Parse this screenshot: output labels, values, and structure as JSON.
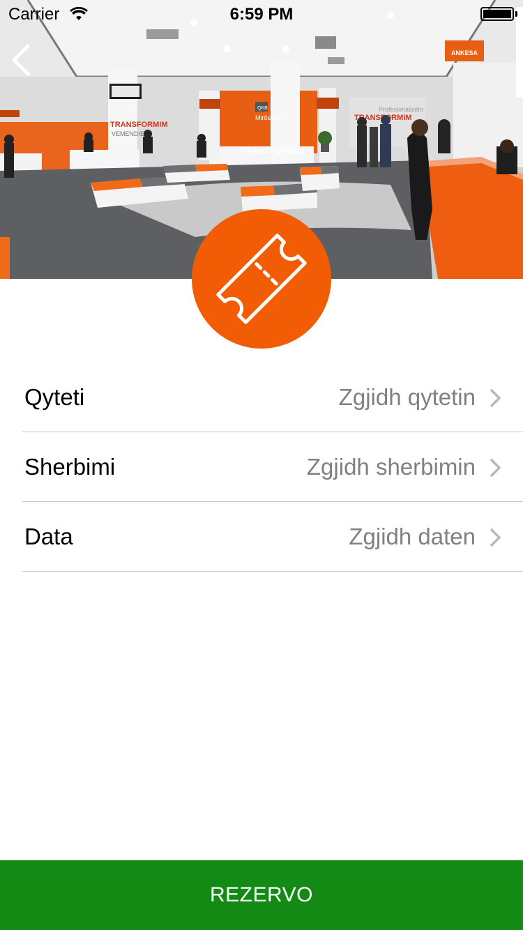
{
  "status_bar": {
    "carrier": "Carrier",
    "time": "6:59 PM",
    "wifi_icon": "wifi-icon",
    "battery_icon": "battery-icon",
    "battery_level": 1.0
  },
  "nav": {
    "back_icon": "chevron-left-icon"
  },
  "hero": {
    "image": "office-service-hall-photo",
    "ticket_icon": "ticket-icon",
    "badge_color": "#f25c05",
    "signs": {
      "ankesa": "ANKESA",
      "transformim": "TRANSFORMIM",
      "profesionalizem": "Profesionalizëm",
      "mendie": "VEMENDIE",
      "sjellje": "Mirësjellje",
      "qkb": "QKB"
    }
  },
  "form": {
    "rows": [
      {
        "label": "Qyteti",
        "value": "Zgjidh qytetin"
      },
      {
        "label": "Sherbimi",
        "value": "Zgjidh sherbimin"
      },
      {
        "label": "Data",
        "value": "Zgjidh daten"
      }
    ],
    "chevron_icon": "chevron-right-icon"
  },
  "actions": {
    "reserve_label": "REZERVO",
    "reserve_color": "#138a13"
  }
}
